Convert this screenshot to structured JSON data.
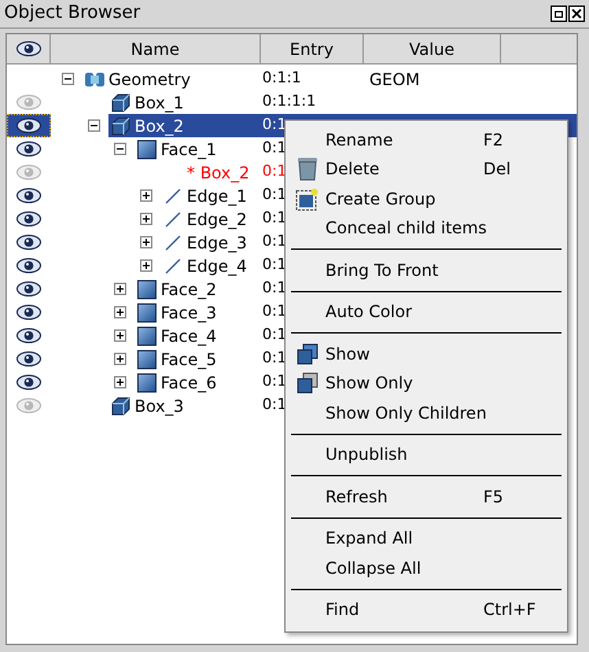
{
  "window": {
    "title": "Object Browser"
  },
  "columns": [
    {
      "label": "Name"
    },
    {
      "label": "Entry"
    },
    {
      "label": "Value"
    }
  ],
  "tree": [
    {
      "name": "Geometry",
      "entry": "0:1:1",
      "value": "GEOM",
      "kind": "component",
      "expanded": true,
      "selected": false,
      "children": [
        {
          "name": "Box_1",
          "entry": "0:1:1:1",
          "kind": "box",
          "visible": false,
          "selected": false
        },
        {
          "name": "Box_2",
          "entry": "0:1",
          "kind": "box",
          "visible": true,
          "expanded": true,
          "selected": true,
          "children": [
            {
              "name": "Face_1",
              "entry": "0:1",
              "kind": "face",
              "visible": true,
              "expanded": true,
              "selected": false,
              "children": [
                {
                  "name": "* Box_2",
                  "entry": "0:1",
                  "kind": "reference",
                  "visible": false,
                  "selected": false
                },
                {
                  "name": "Edge_1",
                  "entry": "0:1",
                  "kind": "edge",
                  "visible": true,
                  "expanded": false,
                  "selected": false
                },
                {
                  "name": "Edge_2",
                  "entry": "0:1",
                  "kind": "edge",
                  "visible": true,
                  "expanded": false,
                  "selected": false
                },
                {
                  "name": "Edge_3",
                  "entry": "0:1",
                  "kind": "edge",
                  "visible": true,
                  "expanded": false,
                  "selected": false
                },
                {
                  "name": "Edge_4",
                  "entry": "0:1",
                  "kind": "edge",
                  "visible": true,
                  "expanded": false,
                  "selected": false
                }
              ]
            },
            {
              "name": "Face_2",
              "entry": "0:1",
              "kind": "face",
              "visible": true,
              "expanded": false,
              "selected": false
            },
            {
              "name": "Face_3",
              "entry": "0:1",
              "kind": "face",
              "visible": true,
              "expanded": false,
              "selected": false
            },
            {
              "name": "Face_4",
              "entry": "0:1",
              "kind": "face",
              "visible": true,
              "expanded": false,
              "selected": false
            },
            {
              "name": "Face_5",
              "entry": "0:1",
              "kind": "face",
              "visible": true,
              "expanded": false,
              "selected": false
            },
            {
              "name": "Face_6",
              "entry": "0:1",
              "kind": "face",
              "visible": true,
              "expanded": false,
              "selected": false
            }
          ]
        },
        {
          "name": "Box_3",
          "entry": "0:1",
          "kind": "box",
          "visible": false,
          "selected": false
        }
      ]
    }
  ],
  "context_menu": [
    {
      "kind": "item",
      "label": "Rename",
      "shortcut": "F2"
    },
    {
      "kind": "item",
      "label": "Delete",
      "shortcut": "Del"
    },
    {
      "kind": "item",
      "label": "Create Group"
    },
    {
      "kind": "item",
      "label": "Conceal child items"
    },
    {
      "kind": "separator"
    },
    {
      "kind": "item",
      "label": "Bring To Front"
    },
    {
      "kind": "separator"
    },
    {
      "kind": "item",
      "label": "Auto Color"
    },
    {
      "kind": "separator"
    },
    {
      "kind": "item",
      "label": "Show"
    },
    {
      "kind": "item",
      "label": "Show Only"
    },
    {
      "kind": "item",
      "label": "Show Only Children"
    },
    {
      "kind": "separator"
    },
    {
      "kind": "item",
      "label": "Unpublish"
    },
    {
      "kind": "separator"
    },
    {
      "kind": "item",
      "label": "Refresh",
      "shortcut": "F5"
    },
    {
      "kind": "separator"
    },
    {
      "kind": "item",
      "label": "Expand All"
    },
    {
      "kind": "item",
      "label": "Collapse All"
    },
    {
      "kind": "separator"
    },
    {
      "kind": "item",
      "label": "Find",
      "shortcut": "Ctrl+F"
    }
  ]
}
